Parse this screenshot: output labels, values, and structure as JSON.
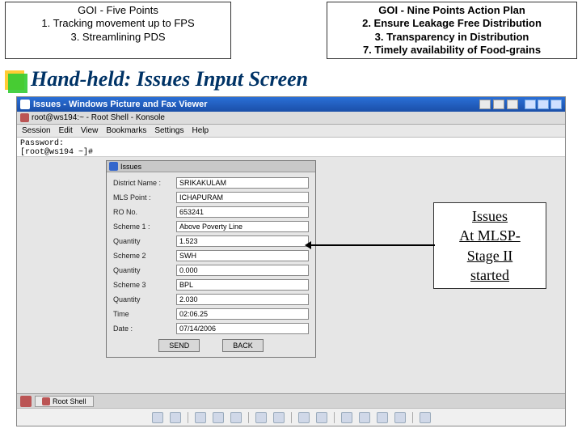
{
  "top": {
    "left": {
      "l1": "GOI - Five Points",
      "l2": "1. Tracking movement up to FPS",
      "l3": "3. Streamlining PDS"
    },
    "right": {
      "l1": "GOI - Nine Points Action Plan",
      "l2": "2. Ensure Leakage Free Distribution",
      "l3": "3. Transparency in Distribution",
      "l4": "7. Timely availability of Food-grains"
    }
  },
  "title": "Hand-held: Issues Input Screen",
  "viewer": {
    "titlebar": "Issues - Windows Picture and Fax Viewer",
    "konsole": "root@ws194:~ - Root Shell - Konsole",
    "menus": [
      "Session",
      "Edit",
      "View",
      "Bookmarks",
      "Settings",
      "Help"
    ],
    "terminal": {
      "l1": "Password:",
      "l2": "[root@ws194 ~]# "
    },
    "form": {
      "title": "Issues",
      "fields": [
        {
          "label": "District Name :",
          "value": "SRIKAKULAM"
        },
        {
          "label": "MLS Point :",
          "value": "ICHAPURAM"
        },
        {
          "label": "RO No.",
          "value": "653241"
        },
        {
          "label": "Scheme 1 :",
          "value": "Above Poverty Line"
        },
        {
          "label": "Quantity",
          "value": "1.523"
        },
        {
          "label": "Scheme 2",
          "value": "SWH"
        },
        {
          "label": "Quantity",
          "value": "0.000"
        },
        {
          "label": "Scheme 3",
          "value": "BPL"
        },
        {
          "label": "Quantity",
          "value": "2.030"
        },
        {
          "label": "Time",
          "value": "02:06.25"
        },
        {
          "label": "Date :",
          "value": "07/14/2006"
        }
      ],
      "buttons": {
        "send": "SEND",
        "back": "BACK"
      }
    },
    "taskbar": {
      "rootshell": "Root Shell"
    }
  },
  "callout": {
    "l1": "Issues",
    "l2": "At MLSP-",
    "l3": "Stage II",
    "l4": "started"
  }
}
